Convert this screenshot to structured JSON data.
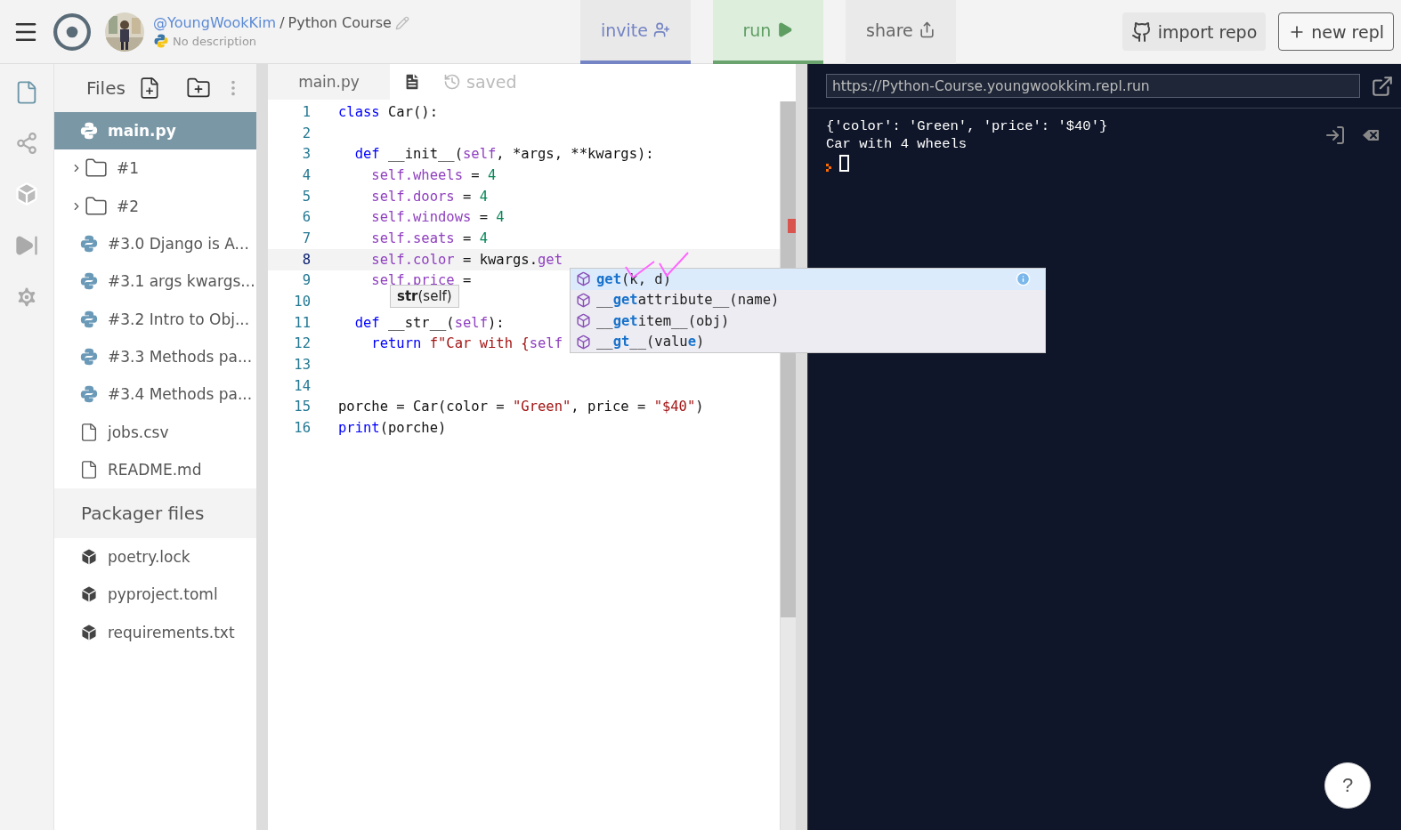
{
  "topbar": {
    "user": "@YoungWookKim",
    "separator": "/",
    "repl_name": "Python Course",
    "description": "No description",
    "actions": [
      {
        "kind": "invite",
        "label": "invite"
      },
      {
        "kind": "run",
        "label": "run"
      },
      {
        "kind": "share",
        "label": "share"
      }
    ],
    "import_label": "import repo",
    "new_label": "new repl"
  },
  "files": {
    "title": "Files",
    "items": [
      {
        "kind": "python",
        "name": "main.py",
        "selected": true
      },
      {
        "kind": "folder",
        "name": "#1",
        "selected": false
      },
      {
        "kind": "folder",
        "name": "#2",
        "selected": false
      },
      {
        "kind": "python",
        "name": "#3.0 Django is A...",
        "selected": false
      },
      {
        "kind": "python",
        "name": "#3.1 args kwargs...",
        "selected": false
      },
      {
        "kind": "python",
        "name": "#3.2 Intro to Obj...",
        "selected": false
      },
      {
        "kind": "python",
        "name": "#3.3 Methods pa...",
        "selected": false
      },
      {
        "kind": "python",
        "name": "#3.4 Methods pa...",
        "selected": false
      },
      {
        "kind": "file",
        "name": "jobs.csv",
        "selected": false
      },
      {
        "kind": "file",
        "name": "README.md",
        "selected": false
      }
    ]
  },
  "packager": {
    "title": "Packager files",
    "items": [
      {
        "kind": "package",
        "name": "poetry.lock"
      },
      {
        "kind": "package",
        "name": "pyproject.toml"
      },
      {
        "kind": "package",
        "name": "requirements.txt"
      }
    ]
  },
  "editor": {
    "tab": "main.py",
    "status": "saved",
    "lines": [
      {
        "number": "1",
        "current": false,
        "tokens": [
          {
            "kind": "keyword",
            "s": "class"
          },
          {
            "kind": "plain",
            "s": " Car():"
          }
        ]
      },
      {
        "number": "2",
        "current": false
      },
      {
        "number": "3",
        "current": false,
        "tokens": [
          {
            "kind": "keyword",
            "s": "  def"
          },
          {
            "kind": "plain",
            "s": " __init__("
          },
          {
            "kind": "self",
            "s": "self"
          },
          {
            "kind": "plain",
            "s": ", *args, **kwargs):"
          }
        ]
      },
      {
        "number": "4",
        "current": false,
        "tokens": [
          {
            "kind": "self",
            "s": "    self.wheels"
          },
          {
            "kind": "plain",
            "s": " = "
          },
          {
            "kind": "number",
            "s": "4"
          }
        ]
      },
      {
        "number": "5",
        "current": false,
        "tokens": [
          {
            "kind": "self",
            "s": "    self.doors"
          },
          {
            "kind": "plain",
            "s": " = "
          },
          {
            "kind": "number",
            "s": "4"
          }
        ]
      },
      {
        "number": "6",
        "current": false,
        "tokens": [
          {
            "kind": "self",
            "s": "    self.windows"
          },
          {
            "kind": "plain",
            "s": " = "
          },
          {
            "kind": "number",
            "s": "4"
          }
        ]
      },
      {
        "number": "7",
        "current": false,
        "tokens": [
          {
            "kind": "self",
            "s": "    self.seats"
          },
          {
            "kind": "plain",
            "s": " = "
          },
          {
            "kind": "number",
            "s": "4"
          }
        ]
      },
      {
        "number": "8",
        "current": true,
        "tokens": [
          {
            "kind": "self",
            "s": "    self.color"
          },
          {
            "kind": "plain",
            "s": " = kwargs."
          },
          {
            "kind": "self",
            "s": "get"
          }
        ]
      },
      {
        "number": "9",
        "current": false,
        "tokens": [
          {
            "kind": "self",
            "s": "    self.price"
          },
          {
            "kind": "plain",
            "s": " ="
          }
        ]
      },
      {
        "number": "10",
        "current": false
      },
      {
        "number": "11",
        "current": false,
        "tokens": [
          {
            "kind": "keyword",
            "s": "  def"
          },
          {
            "kind": "plain",
            "s": " __str__("
          },
          {
            "kind": "self",
            "s": "self"
          },
          {
            "kind": "plain",
            "s": "):"
          }
        ]
      },
      {
        "number": "12",
        "current": false,
        "tokens": [
          {
            "kind": "keyword",
            "s": "    return"
          },
          {
            "kind": "string",
            "s": " f\"Car with {"
          },
          {
            "kind": "self",
            "s": "self"
          }
        ]
      },
      {
        "number": "13",
        "current": false
      },
      {
        "number": "14",
        "current": false
      },
      {
        "number": "15",
        "current": false,
        "tokens": [
          {
            "kind": "plain",
            "s": "porche = Car(color = "
          },
          {
            "kind": "string",
            "s": "\"Green\""
          },
          {
            "kind": "plain",
            "s": ", price = "
          },
          {
            "kind": "string",
            "s": "\"$40\""
          },
          {
            "kind": "plain",
            "s": ")"
          }
        ]
      },
      {
        "number": "16",
        "current": false,
        "tokens": [
          {
            "kind": "keyword",
            "s": "print"
          },
          {
            "kind": "plain",
            "s": "(porche)"
          }
        ]
      }
    ],
    "tooltip": "**str**(self)",
    "suggestions": [
      {
        "selected": true,
        "parts": [
          {
            "match": true,
            "s": "get"
          },
          {
            "match": false,
            "s": "(k, d)"
          }
        ]
      },
      {
        "selected": false,
        "parts": [
          {
            "match": false,
            "s": "__"
          },
          {
            "match": true,
            "s": "get"
          },
          {
            "match": false,
            "s": "attribute__(name)"
          }
        ]
      },
      {
        "selected": false,
        "parts": [
          {
            "match": false,
            "s": "__"
          },
          {
            "match": true,
            "s": "get"
          },
          {
            "match": false,
            "s": "item__(obj)"
          }
        ]
      },
      {
        "selected": false,
        "parts": [
          {
            "match": false,
            "s": "__"
          },
          {
            "match": true,
            "s": "gt"
          },
          {
            "match": false,
            "s": "__(valu"
          },
          {
            "match": true,
            "s": "e"
          },
          {
            "match": false,
            "s": ")"
          }
        ]
      }
    ]
  },
  "console": {
    "url": "https://Python-Course.youngwookkim.repl.run",
    "output": [
      "{'color': 'Green', 'price': '$40'}",
      "Car with 4 wheels"
    ]
  },
  "help": "?"
}
